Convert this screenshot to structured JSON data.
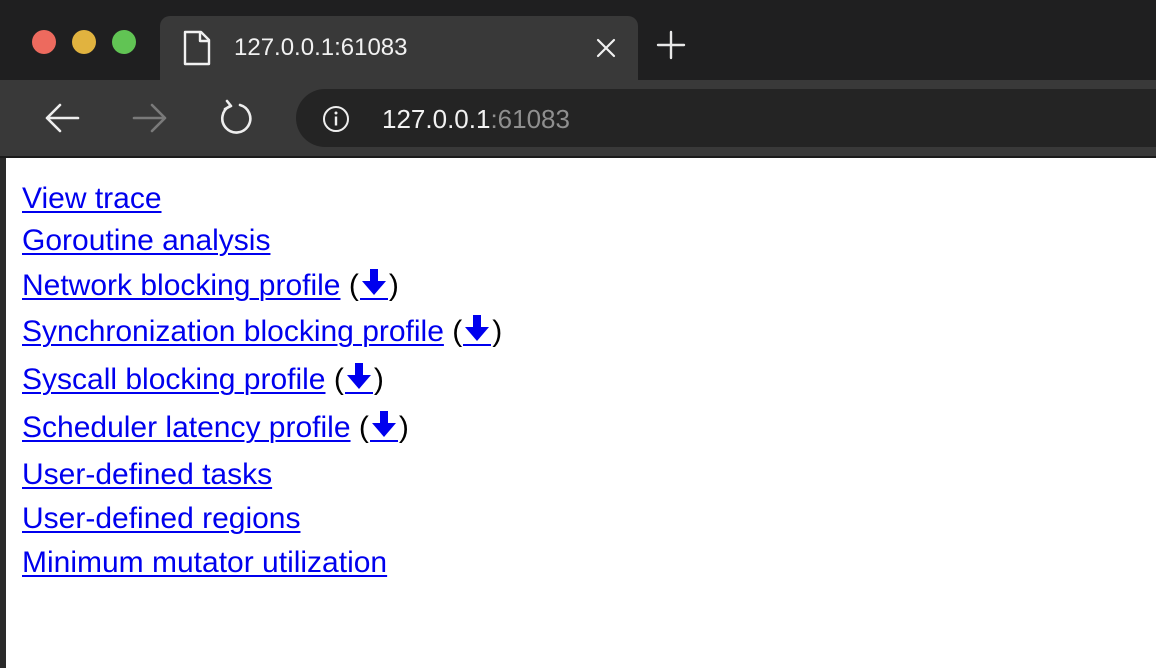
{
  "tab": {
    "title": "127.0.0.1:61083",
    "icon": "page-icon"
  },
  "address_bar": {
    "host": "127.0.0.1",
    "port": ":61083",
    "icon": "info-icon"
  },
  "colors": {
    "link": "#0000ee",
    "tabstrip": "#1f1f20",
    "toolbar": "#393939",
    "omnibox": "#242424"
  },
  "links": [
    {
      "label": "View trace",
      "download": false
    },
    {
      "label": "Goroutine analysis",
      "download": false
    },
    {
      "label": "Network blocking profile",
      "download": true,
      "paren_open": "(",
      "paren_close": ")",
      "download_icon": "download-arrow-icon"
    },
    {
      "label": "Synchronization blocking profile",
      "download": true,
      "paren_open": "(",
      "paren_close": ")",
      "download_icon": "download-arrow-icon"
    },
    {
      "label": "Syscall blocking profile",
      "download": true,
      "paren_open": "(",
      "paren_close": ")",
      "download_icon": "download-arrow-icon"
    },
    {
      "label": "Scheduler latency profile",
      "download": true,
      "paren_open": "(",
      "paren_close": ")",
      "download_icon": "download-arrow-icon"
    },
    {
      "label": "User-defined tasks",
      "download": false
    },
    {
      "label": "User-defined regions",
      "download": false
    },
    {
      "label": "Minimum mutator utilization",
      "download": false
    }
  ]
}
